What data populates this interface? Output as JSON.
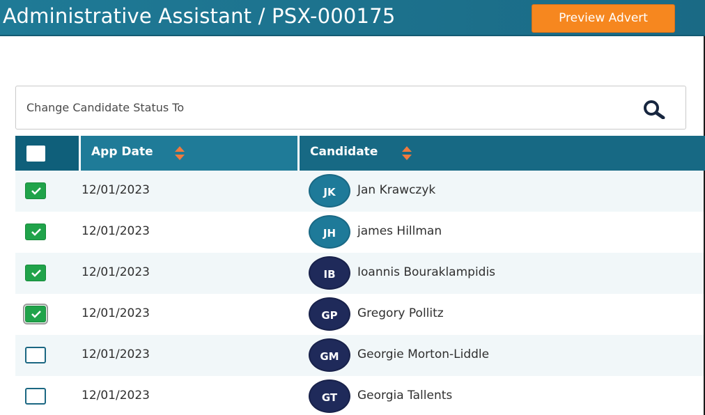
{
  "header": {
    "title": "Administrative Assistant / PSX-000175",
    "preview_label": "Preview Advert"
  },
  "search": {
    "placeholder": "Change Candidate Status To"
  },
  "table": {
    "columns": [
      {
        "key": "select",
        "label": ""
      },
      {
        "key": "app_date",
        "label": "App Date"
      },
      {
        "key": "candidate",
        "label": "Candidate"
      }
    ],
    "rows": [
      {
        "checked": true,
        "date": "12/01/2023",
        "initials": "JK",
        "name": "Jan Krawczyk",
        "avatar_color": "#1e7a99"
      },
      {
        "checked": true,
        "date": "12/01/2023",
        "initials": "JH",
        "name": "james Hillman",
        "avatar_color": "#1e7a99"
      },
      {
        "checked": true,
        "date": "12/01/2023",
        "initials": "IB",
        "name": "Ioannis Bouraklampidis",
        "avatar_color": "#1f2a5a"
      },
      {
        "checked": true,
        "date": "12/01/2023",
        "initials": "GP",
        "name": "Gregory Pollitz",
        "avatar_color": "#1f2a5a"
      },
      {
        "checked": false,
        "date": "12/01/2023",
        "initials": "GM",
        "name": "Georgie Morton-Liddle",
        "avatar_color": "#1f2a5a"
      },
      {
        "checked": false,
        "date": "12/01/2023",
        "initials": "GT",
        "name": "Georgia Tallents",
        "avatar_color": "#1f2a5a"
      }
    ]
  },
  "colors": {
    "header_bg": "#1f7a96",
    "accent_orange": "#f6871f",
    "check_green": "#20a34a",
    "avatar_teal": "#1e7a99",
    "avatar_navy": "#1f2a5a"
  },
  "icons": {
    "search": "search-icon",
    "sort": "sort-icon",
    "check": "checkmark-icon"
  }
}
